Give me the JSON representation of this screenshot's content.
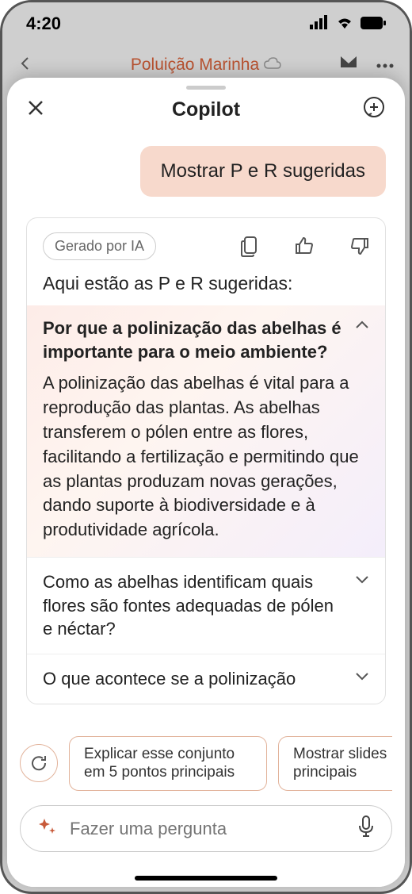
{
  "status": {
    "time": "4:20"
  },
  "bg": {
    "title": "Poluição Marinha"
  },
  "sheet": {
    "title": "Copilot"
  },
  "chat": {
    "user_msg": "Mostrar P e R sugeridas",
    "ai_badge": "Gerado por IA",
    "ai_intro": "Aqui estão as P e R sugeridas:",
    "qa": [
      {
        "q": "Por que a polinização das abelhas é importante para o meio ambiente?",
        "a": "A polinização das abelhas é vital para a reprodução das plantas. As abelhas transferem o pólen entre as flores, facilitando a fertilização e permitindo que as plantas produzam novas gerações, dando suporte à biodiversidade e à produtividade agrícola.",
        "expanded": true
      },
      {
        "q": "Como as abelhas identificam quais flores são fontes adequadas de pólen e néctar?",
        "expanded": false
      },
      {
        "q": "O que acontece se a polinização",
        "expanded": false
      }
    ]
  },
  "suggestions": [
    "Explicar esse conjunto em 5 pontos principais",
    "Mostrar slides principais"
  ],
  "input": {
    "placeholder": "Fazer uma pergunta"
  }
}
